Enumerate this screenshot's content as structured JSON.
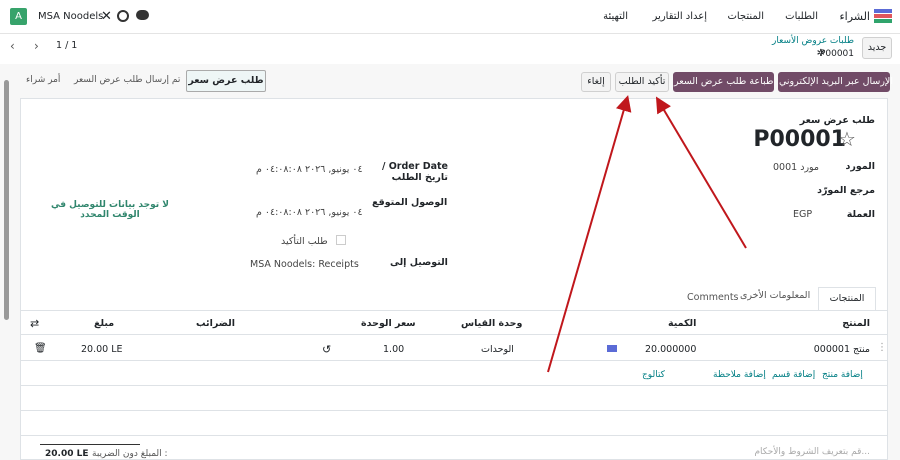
{
  "topbar": {
    "avatar_letter": "A",
    "company": "MSA Noodels",
    "menu": [
      "الشراء",
      "الطلبات",
      "المنتجات",
      "إعداد التقارير",
      "التهيئة"
    ]
  },
  "control": {
    "new_label": "جديد",
    "breadcrumb_parent": "طلبات عروض الأسعار",
    "record_name": "P00001",
    "pager": "1 / 1"
  },
  "actions": {
    "send_email": "الإرسال عبر البريد الإلكتروني",
    "print_rfq": "طباعة طلب عرض السعر",
    "confirm_order": "تأكيد الطلب",
    "cancel": "إلغاء"
  },
  "status": {
    "steps": [
      "طلب عرض سعر",
      "تم إرسال طلب عرض السعر",
      "أمر شراء"
    ],
    "active_index": 0
  },
  "form": {
    "kind": "طلب عرض سعر",
    "name": "P00001",
    "vendor_label": "المورد",
    "vendor_value": "مورد 0001",
    "vendor_ref_label": "مرجع المورّد",
    "currency_label": "العملة",
    "currency_value": "EGP",
    "order_date_label": "Order Date / تاريخ الطلب",
    "order_date_value": "٠٤ يونيو, ٢٠٢٦ ٠٤:٠٨:٠٨ م",
    "expected_label": "الوصول المتوقع",
    "expected_value": "٠٤ يونيو, ٢٠٢٦ ٠٤:٠٨:٠٨ م",
    "confirm_label": "طلب التأكيد",
    "deliver_to_label": "التوصيل إلى",
    "deliver_to_value": "MSA Noodels: Receipts",
    "no_data": "لا توجد بيانات للتوصيل في الوقت المحدد"
  },
  "tabs": [
    "المنتجات",
    "المعلومات الأخرى",
    "Comments"
  ],
  "table": {
    "headers": [
      "المنتج",
      "الكمية",
      "وحدة القياس",
      "سعر الوحدة",
      "الضرائب",
      "مبلغ"
    ],
    "rows": [
      {
        "product": "منتج 000001",
        "qty": "20.000000",
        "uom": "الوحدات",
        "price": "1.00",
        "taxes": "",
        "amount": "20.00 LE"
      }
    ],
    "links": [
      "إضافة منتج",
      "إضافة قسم",
      "إضافة ملاحظة",
      "كتالوج"
    ]
  },
  "footer": {
    "terms_placeholder": "قم بتعريف الشروط والأحكام...",
    "untaxed_label": "المبلغ دون الضريبة :",
    "untaxed_value": "20.00 LE"
  },
  "colors": {
    "brand": "#714b67",
    "teal": "#017e84",
    "annotation": "#c0171c"
  }
}
